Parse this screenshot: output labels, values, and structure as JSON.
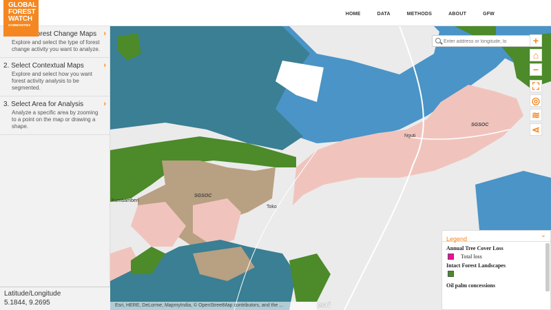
{
  "header": {
    "logo": {
      "line1": "GLOBAL",
      "line2": "FOREST",
      "line3": "WATCH",
      "line4": "COMMODITIES"
    },
    "nav": [
      "HOME",
      "DATA",
      "METHODS",
      "ABOUT",
      "GFW"
    ]
  },
  "sidebar": {
    "steps": [
      {
        "title": "1. Select Forest Change Maps",
        "desc": "Explore and select the type of forest change activity you want to analyze."
      },
      {
        "title": "2. Select Contextual Maps",
        "desc": "Explore and select how you want forest activity analysis to be segmented."
      },
      {
        "title": "3. Select Area for Analysis",
        "desc": "Analyze a specific area by zooming to a point on the map or drawing a shape."
      }
    ],
    "latlon": {
      "label": "Latitude/Longitude",
      "value": "5.1844, 9.2695"
    }
  },
  "map": {
    "search_placeholder": "Enter address or longitude, lo",
    "labels": {
      "sgsoc1": "SGSOC",
      "sgsoc2": "SGSOC",
      "nguti": "Nguti",
      "toko": "Toko",
      "kumbi": "Kumbamberi"
    },
    "attribution": "Esri, HERE, DeLorme, MapmyIndia, © OpenStreetMap contributors, and the ...",
    "esri": "esri"
  },
  "tools": [
    "plus-icon",
    "home-icon",
    "minus-icon",
    "fullscreen-icon",
    "locate-icon",
    "layers-icon",
    "share-icon"
  ],
  "legend": {
    "title": "Legend",
    "groups": [
      {
        "name": "Annual Tree Cover Loss",
        "item": "Total loss",
        "color": "#ee0e9d"
      },
      {
        "name": "Intact Forest Landscapes",
        "item": "",
        "color": "#4a8a2a"
      },
      {
        "name": "Oil palm concessions",
        "item": "",
        "color": ""
      }
    ]
  },
  "colors": {
    "accent": "#f48720",
    "water": "#4a94c7",
    "forest": "#4c8a2a",
    "teal": "#3a7f93",
    "tan": "#b8a082",
    "pink": "#f0c4bd"
  }
}
